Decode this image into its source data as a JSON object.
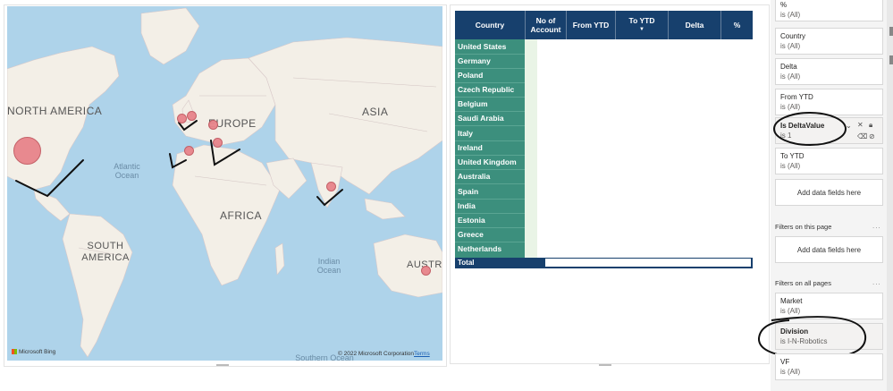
{
  "map": {
    "continents": [
      "NORTH AMERICA",
      "EUROPE",
      "ASIA",
      "AFRICA",
      "SOUTH AMERICA",
      "AUSTR"
    ],
    "oceans": [
      "Atlantic Ocean",
      "Indian Ocean",
      "Southern Ocean"
    ],
    "logo": "Microsoft Bing",
    "copyright": "© 2022 Microsoft Corporation",
    "terms": "Terms",
    "bubble_color": "#e8848b"
  },
  "table": {
    "columns": [
      "Country",
      "No of Account",
      "From YTD",
      "To YTD",
      "Delta",
      "%"
    ],
    "countries": [
      "United States",
      "Germany",
      "Poland",
      "Czech Republic",
      "Belgium",
      "Saudi Arabia",
      "Italy",
      "Ireland",
      "United Kingdom",
      "Australia",
      "Spain",
      "India",
      "Estonia",
      "Greece",
      "Netherlands"
    ],
    "total_label": "Total",
    "header_color": "#17406d",
    "country_color": "#3c8f7d"
  },
  "filters": {
    "visual_filters": [
      {
        "name": "%",
        "value": "is (All)"
      },
      {
        "name": "Country",
        "value": "is (All)"
      },
      {
        "name": "Delta",
        "value": "is (All)"
      },
      {
        "name": "From YTD",
        "value": "is (All)"
      },
      {
        "name": "Is DeltaValue",
        "value": "is 1"
      },
      {
        "name": "To YTD",
        "value": "is (All)"
      }
    ],
    "add_data_fields": "Add data fields here",
    "page_section": "Filters on this page",
    "all_pages_section": "Filters on all pages",
    "all_page_filters": [
      {
        "name": "Market",
        "value": "is (All)"
      },
      {
        "name": "Division",
        "value": "is I-N-Robotics"
      },
      {
        "name": "VF",
        "value": "is (All)"
      }
    ],
    "more": "..."
  }
}
